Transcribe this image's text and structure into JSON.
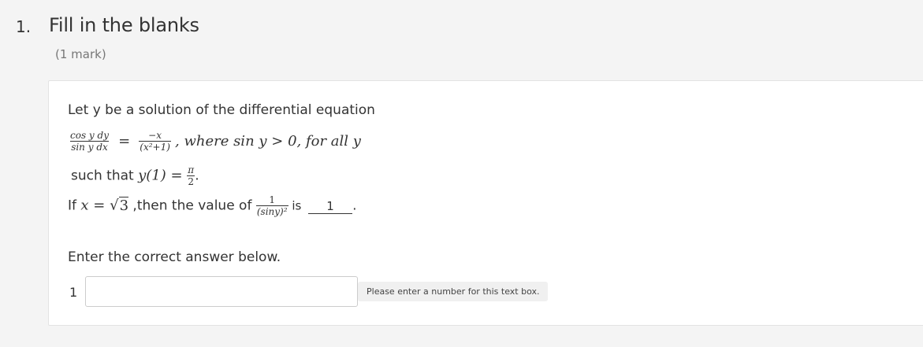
{
  "question": {
    "number": "1.",
    "title": "Fill in the blanks",
    "mark": "(1 mark)"
  },
  "content": {
    "intro": "Let y be a solution of the differential equation",
    "eq_lhs_num": "cos y dy",
    "eq_lhs_den": "sin y dx",
    "eq_equals": "=",
    "eq_rhs_num": "−x",
    "eq_rhs_den": "(x²+1)",
    "eq_where": ", where sin y > 0, for all y",
    "such_that_text": "such that ",
    "condition": "y(1) = ",
    "condition_pi": "π",
    "condition_two": "2",
    "if_text": "If ",
    "x_eq": "x = ",
    "sqrt_sym": "√",
    "sqrt_val": "3",
    "then_text": " ,then the value of ",
    "frac2_num": "1",
    "frac2_den": "(siny)²",
    "is_text": " is ",
    "blank_value": "1",
    "period": "."
  },
  "answer": {
    "prompt": "Enter the correct answer below.",
    "index": "1",
    "value": "",
    "hint": "Please enter a number for this text box."
  }
}
